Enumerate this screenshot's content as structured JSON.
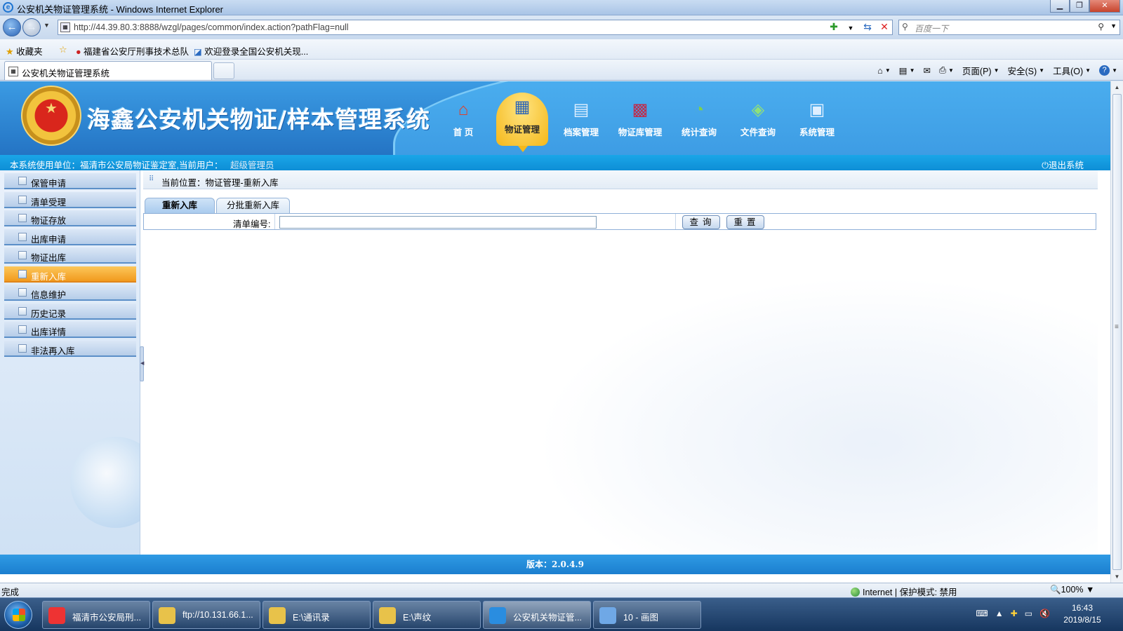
{
  "window": {
    "title": "公安机关物证管理系统 - Windows Internet Explorer"
  },
  "browser": {
    "url": "http://44.39.80.3:8888/wzgl/pages/common/index.action?pathFlag=null",
    "search_placeholder": "百度一下",
    "favorites_label": "收藏夹",
    "favorites": [
      "福建省公安厅刑事技术总队",
      "欢迎登录全国公安机关现..."
    ],
    "tab_title": "公安机关物证管理系统",
    "commands": [
      "页面(P)",
      "安全(S)",
      "工具(O)"
    ]
  },
  "app": {
    "system_name": "海鑫公安机关物证/样本管理系统",
    "top_nav": [
      {
        "label": "首  页",
        "icon": "home-icon",
        "glyph": "⌂",
        "color": "#e0402a"
      },
      {
        "label": "物证管理",
        "icon": "calendar-icon",
        "glyph": "▦",
        "color": "#2a64b8",
        "active": true
      },
      {
        "label": "档案管理",
        "icon": "document-icon",
        "glyph": "▤",
        "color": "#dfefff"
      },
      {
        "label": "物证库管理",
        "icon": "storage-icon",
        "glyph": "▩",
        "color": "#c02a4a"
      },
      {
        "label": "统计查询",
        "icon": "chart-search-icon",
        "glyph": "◔",
        "color": "#7fd04a"
      },
      {
        "label": "文件查询",
        "icon": "file-search-icon",
        "glyph": "◈",
        "color": "#8fe07a"
      },
      {
        "label": "系统管理",
        "icon": "monitor-icon",
        "glyph": "▣",
        "color": "#dfefff"
      }
    ],
    "info_label": "本系统使用单位：福清市公安局物证鉴定室,当前用户：",
    "current_user": "超级管理员",
    "logout": "退出系统",
    "left_menu": [
      {
        "label": "保管申请"
      },
      {
        "label": "清单受理"
      },
      {
        "label": "物证存放"
      },
      {
        "label": "出库申请"
      },
      {
        "label": "物证出库"
      },
      {
        "label": "重新入库",
        "active": true
      },
      {
        "label": "信息维护"
      },
      {
        "label": "历史记录"
      },
      {
        "label": "出库详情"
      },
      {
        "label": "非法再入库"
      }
    ],
    "breadcrumb": "当前位置：物证管理-重新入库",
    "tabs": [
      "重新入库",
      "分批重新入库"
    ],
    "form": {
      "list_number_label": "清单编号:",
      "list_number_value": "",
      "query_button": "查询",
      "reset_button": "重置"
    },
    "version": "版本：2.0.4.9"
  },
  "status": {
    "text": "完成",
    "zone": "Internet | 保护模式: 禁用",
    "zoom": "100%"
  },
  "taskbar": {
    "tasks": [
      {
        "label": "福清市公安局刑...",
        "color": "#e33"
      },
      {
        "label": "ftp://10.131.66.1...",
        "color": "#e8c24a"
      },
      {
        "label": "E:\\通讯录",
        "color": "#e8c24a"
      },
      {
        "label": "E:\\声纹",
        "color": "#e8c24a"
      },
      {
        "label": "公安机关物证管...",
        "color": "#2a8de0",
        "active": true
      },
      {
        "label": "10 - 画图",
        "color": "#6fa8e6"
      }
    ],
    "time": "16:43",
    "date": "2019/8/15"
  }
}
